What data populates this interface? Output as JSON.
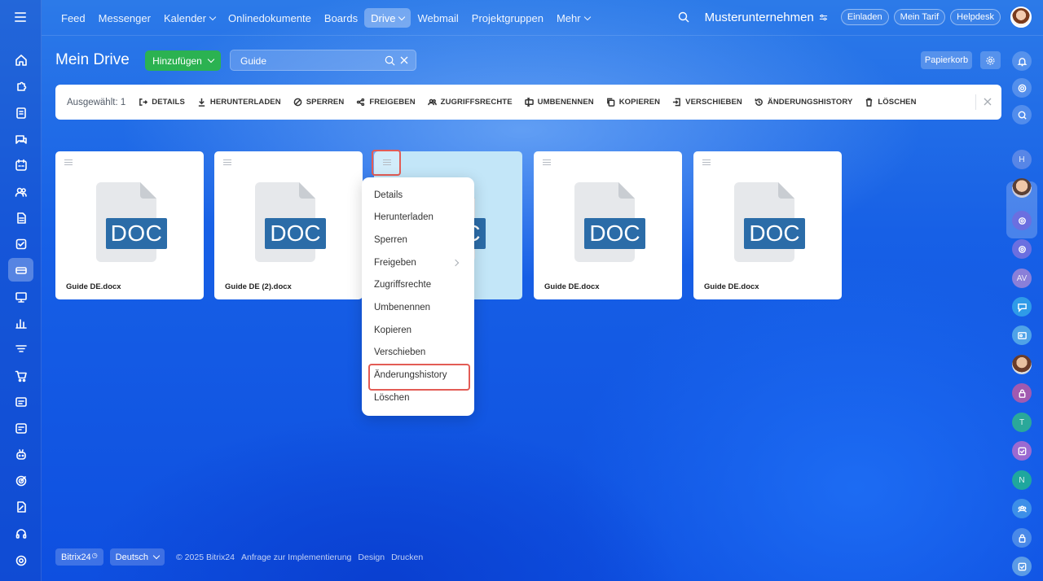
{
  "nav": {
    "items": [
      {
        "label": "Feed"
      },
      {
        "label": "Messenger"
      },
      {
        "label": "Kalender",
        "dropdown": true
      },
      {
        "label": "Onlinedokumente"
      },
      {
        "label": "Boards"
      },
      {
        "label": "Drive",
        "dropdown": true,
        "active": true
      },
      {
        "label": "Webmail"
      },
      {
        "label": "Projektgruppen"
      },
      {
        "label": "Mehr",
        "dropdown": true
      }
    ]
  },
  "header": {
    "company": "Musterunternehmen",
    "invite": "Einladen",
    "tariff": "Mein Tarif",
    "helpdesk": "Helpdesk"
  },
  "page": {
    "title": "Mein Drive",
    "add_button": "Hinzufügen",
    "search_value": "Guide",
    "trash": "Papierkorb"
  },
  "actionbar": {
    "selected": "Ausgewählt: 1",
    "actions": [
      "DETAILS",
      "HERUNTERLADEN",
      "SPERREN",
      "FREIGEBEN",
      "ZUGRIFFSRECHTE",
      "UMBENENNEN",
      "KOPIEREN",
      "VERSCHIEBEN",
      "ÄNDERUNGSHISTORY",
      "LÖSCHEN"
    ]
  },
  "files": [
    {
      "name": "Guide DE.docx",
      "type": "DOC"
    },
    {
      "name": "Guide DE (2).docx",
      "type": "DOC"
    },
    {
      "name": "",
      "type": "DOC",
      "selected": true
    },
    {
      "name": "Guide DE.docx",
      "type": "DOC"
    },
    {
      "name": "Guide DE.docx",
      "type": "DOC"
    }
  ],
  "context_menu": {
    "items": [
      "Details",
      "Herunterladen",
      "Sperren",
      "Freigeben",
      "Zugriffsrechte",
      "Umbenennen",
      "Kopieren",
      "Verschieben",
      "Änderungshistory",
      "Löschen"
    ],
    "highlighted": "Änderungshistory"
  },
  "footer": {
    "brand": "Bitrix24",
    "language": "Deutsch",
    "copyright": "© 2025 Bitrix24",
    "links": [
      "Anfrage zur Implementierung",
      "Design",
      "Drucken"
    ]
  },
  "right_panel": {
    "initials": [
      "H",
      "AV",
      "T",
      "N"
    ]
  },
  "colors": {
    "accent_green": "#2bb251",
    "doc_blue": "#2b6ca8",
    "highlight_red": "#e35c55",
    "selected_card": "#c3e6f8"
  }
}
